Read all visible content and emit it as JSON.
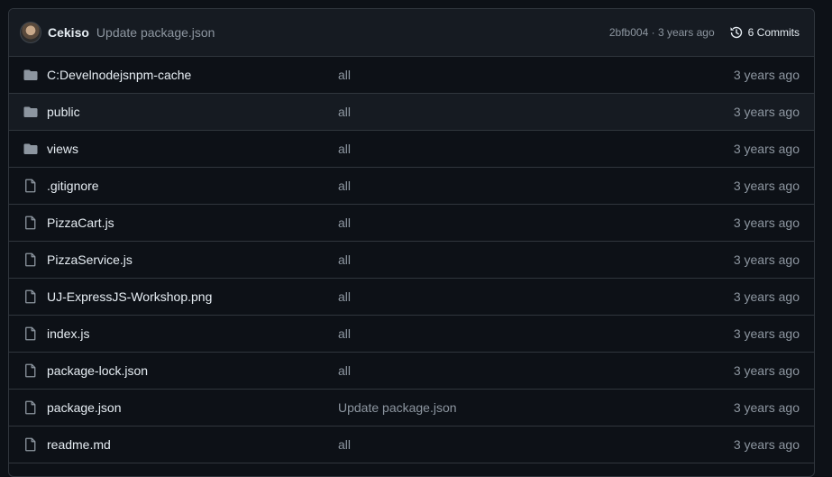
{
  "header": {
    "author": "Cekiso",
    "commit_message": "Update package.json",
    "commit_hash": "2bfb004",
    "separator": "·",
    "commit_age": "3 years ago",
    "commits_label": "6 Commits"
  },
  "files": [
    {
      "name": "C:Develnodejsnpm-cache",
      "type": "folder",
      "message": "all",
      "age": "3 years ago"
    },
    {
      "name": "public",
      "type": "folder",
      "message": "all",
      "age": "3 years ago"
    },
    {
      "name": "views",
      "type": "folder",
      "message": "all",
      "age": "3 years ago"
    },
    {
      "name": ".gitignore",
      "type": "file",
      "message": "all",
      "age": "3 years ago"
    },
    {
      "name": "PizzaCart.js",
      "type": "file",
      "message": "all",
      "age": "3 years ago"
    },
    {
      "name": "PizzaService.js",
      "type": "file",
      "message": "all",
      "age": "3 years ago"
    },
    {
      "name": "UJ-ExpressJS-Workshop.png",
      "type": "file",
      "message": "all",
      "age": "3 years ago"
    },
    {
      "name": "index.js",
      "type": "file",
      "message": "all",
      "age": "3 years ago"
    },
    {
      "name": "package-lock.json",
      "type": "file",
      "message": "all",
      "age": "3 years ago"
    },
    {
      "name": "package.json",
      "type": "file",
      "message": "Update package.json",
      "age": "3 years ago"
    },
    {
      "name": "readme.md",
      "type": "file",
      "message": "all",
      "age": "3 years ago"
    }
  ],
  "colors": {
    "background": "#0d1117",
    "header_bg": "#161b22",
    "border": "#30363d",
    "icon": "#8d96a0",
    "text": "#e6edf3",
    "muted": "#8d96a0"
  }
}
